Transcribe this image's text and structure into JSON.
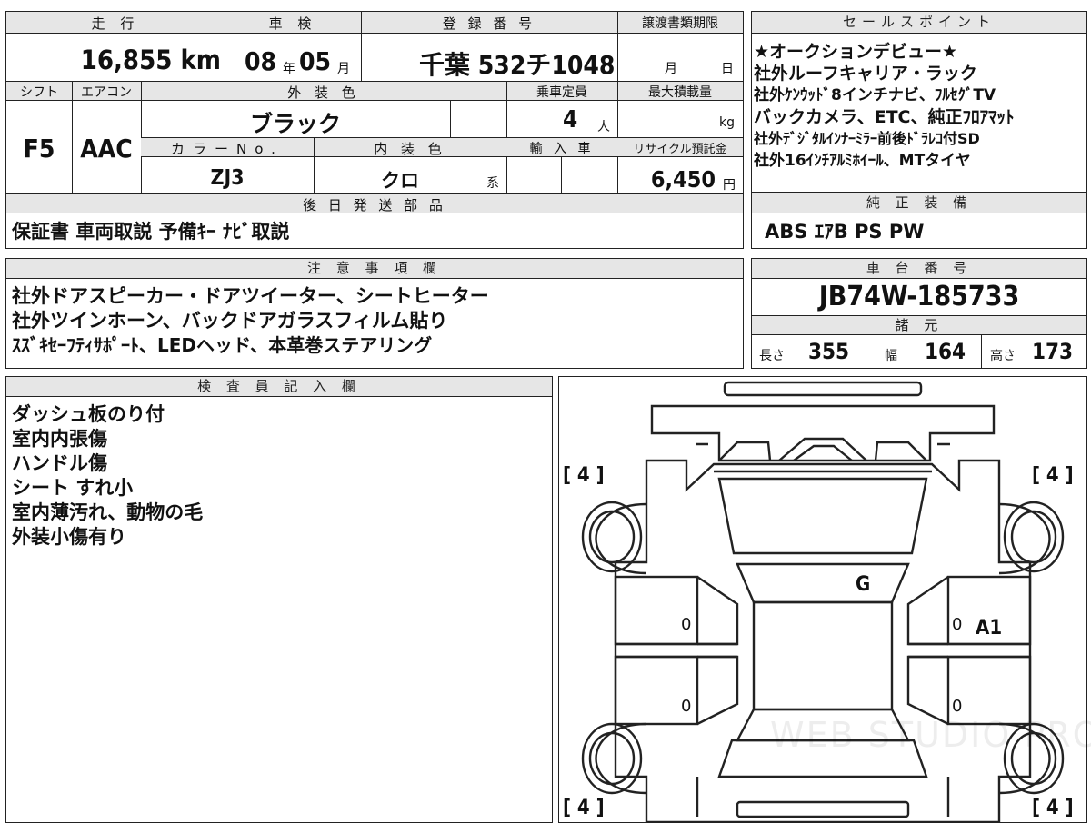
{
  "top": {
    "mileage_label": "走 行",
    "mileage": "16,855 km",
    "inspection_label": "車 検",
    "inspection_year": "08",
    "inspection_year_unit": "年",
    "inspection_month": "05",
    "inspection_month_unit": "月",
    "reg_label": "登 録 番 号",
    "reg_number": "千葉 532チ1048",
    "transfer_label": "譲渡書類期限",
    "transfer_month": "月",
    "transfer_day": "日",
    "shift_label": "シフト",
    "shift": "F5",
    "ac_label": "エアコン",
    "ac": "AAC",
    "ext_color_label": "外 装 色",
    "ext_color": "ブラック",
    "capacity_label": "乗車定員",
    "capacity": "4",
    "capacity_unit": "人",
    "load_label": "最大積載量",
    "load_unit": "kg",
    "color_no_label": "カラーNo.",
    "color_no": "ZJ3",
    "int_color_label": "内 装 色",
    "int_color": "クロ",
    "int_color_suffix": "系",
    "import_label": "輸 入 車",
    "recycle_label": "リサイクル預託金",
    "recycle": "6,450",
    "recycle_unit": "円",
    "later_label": "後 日 発 送 部 品",
    "later_items": "保証書 車両取説 予備ｷｰ ﾅﾋﾞ取説"
  },
  "sales": {
    "title": "セールスポイント",
    "lines": [
      "★オークションデビュー★",
      "社外ルーフキャリア・ラック",
      "社外ｹﾝｳｯﾄﾞ8インチナビ、ﾌﾙｾｸﾞTV",
      "バックカメラ、ETC、純正ﾌﾛｱﾏｯﾄ",
      "社外ﾃﾞｼﾞﾀﾙｲﾝﾅｰﾐﾗｰ前後ﾄﾞﾗﾚｺ付SD",
      "社外16ｲﾝﾁｱﾙﾐﾎｲｰﾙ、MTタイヤ"
    ]
  },
  "equipment": {
    "title": "純 正 装 備",
    "items": "ABS ｴｱB PS PW"
  },
  "notes": {
    "title": "注 意 事 項 欄",
    "lines": [
      "社外ドアスピーカー・ドアツイーター、シートヒーター",
      "社外ツインホーン、バックドアガラスフィルム貼り",
      "ｽｽﾞｷｾｰﾌﾃｨｻﾎﾟｰﾄ、LEDヘッド、本革巻ステアリング"
    ]
  },
  "chassis": {
    "title": "車 台 番 号",
    "number": "JB74W-185733"
  },
  "specs": {
    "title": "諸 元",
    "length_label": "長さ",
    "length": "355",
    "width_label": "幅",
    "width": "164",
    "height_label": "高さ",
    "height": "173"
  },
  "inspector": {
    "title": "検 査 員 記 入 欄",
    "lines": [
      "ダッシュ板のり付",
      "室内内張傷",
      "ハンドル傷",
      "シート すれ小",
      "室内薄汚れ、動物の毛",
      "外装小傷有り"
    ]
  },
  "diagram": {
    "tire_fl": "[ 4 ]",
    "tire_fr": "[ 4 ]",
    "tire_rl": "[ 4 ]",
    "tire_rr": "[ 4 ]",
    "mark_g": "G",
    "mark_a1": "A1",
    "door_marks": [
      "0",
      "0",
      "0",
      "0"
    ],
    "watermark": "WEB STUDIO PRO"
  }
}
